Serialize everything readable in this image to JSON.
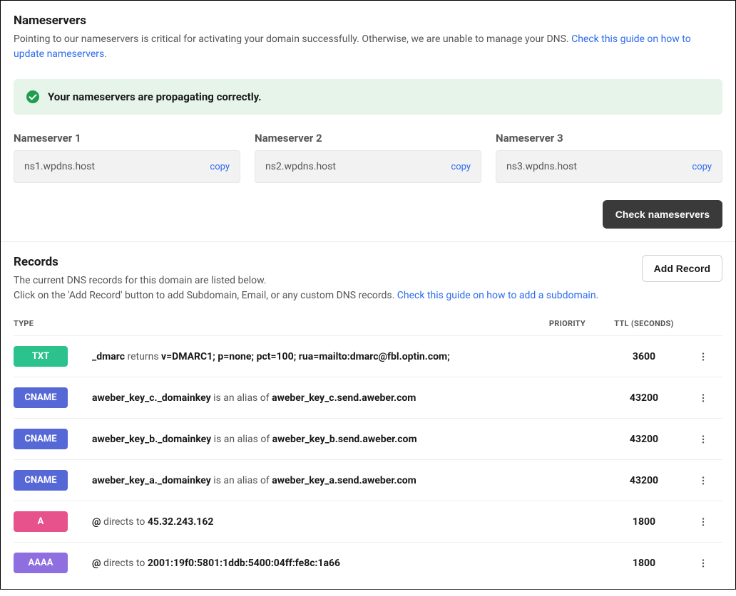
{
  "nameservers": {
    "title": "Nameservers",
    "desc_prefix": "Pointing to our nameservers is critical for activating your domain successfully. Otherwise, we are unable to manage your DNS. ",
    "desc_link": "Check this guide on how to update nameservers",
    "desc_suffix": ".",
    "alert_text": "Your nameservers are propagating correctly.",
    "items": [
      {
        "label": "Nameserver 1",
        "value": "ns1.wpdns.host",
        "copy": "copy"
      },
      {
        "label": "Nameserver 2",
        "value": "ns2.wpdns.host",
        "copy": "copy"
      },
      {
        "label": "Nameserver 3",
        "value": "ns3.wpdns.host",
        "copy": "copy"
      }
    ],
    "check_button": "Check nameservers"
  },
  "records": {
    "title": "Records",
    "desc_line1": "The current DNS records for this domain are listed below.",
    "desc_line2_prefix": "Click on the 'Add Record' button to add Subdomain, Email, or any custom DNS records. ",
    "desc_line2_link": "Check this guide on how to add a subdomain",
    "desc_line2_suffix": ".",
    "add_button": "Add Record",
    "columns": {
      "type": "TYPE",
      "priority": "PRIORITY",
      "ttl": "TTL (SECONDS)"
    },
    "rows": [
      {
        "type": "TXT",
        "badge_class": "badge-txt",
        "name": "_dmarc",
        "verb": " returns ",
        "target": "v=DMARC1; p=none; pct=100; rua=mailto:dmarc@fbl.optin.com;",
        "priority": "",
        "ttl": "3600"
      },
      {
        "type": "CNAME",
        "badge_class": "badge-cname",
        "name": "aweber_key_c._domainkey",
        "verb": " is an alias of ",
        "target": "aweber_key_c.send.aweber.com",
        "priority": "",
        "ttl": "43200"
      },
      {
        "type": "CNAME",
        "badge_class": "badge-cname",
        "name": "aweber_key_b._domainkey",
        "verb": " is an alias of ",
        "target": "aweber_key_b.send.aweber.com",
        "priority": "",
        "ttl": "43200"
      },
      {
        "type": "CNAME",
        "badge_class": "badge-cname",
        "name": "aweber_key_a._domainkey",
        "verb": " is an alias of ",
        "target": "aweber_key_a.send.aweber.com",
        "priority": "",
        "ttl": "43200"
      },
      {
        "type": "A",
        "badge_class": "badge-a",
        "name": "@",
        "verb": " directs to ",
        "target": "45.32.243.162",
        "priority": "",
        "ttl": "1800"
      },
      {
        "type": "AAAA",
        "badge_class": "badge-aaaa",
        "name": "@",
        "verb": " directs to ",
        "target": "2001:19f0:5801:1ddb:5400:04ff:fe8c:1a66",
        "priority": "",
        "ttl": "1800"
      }
    ]
  }
}
